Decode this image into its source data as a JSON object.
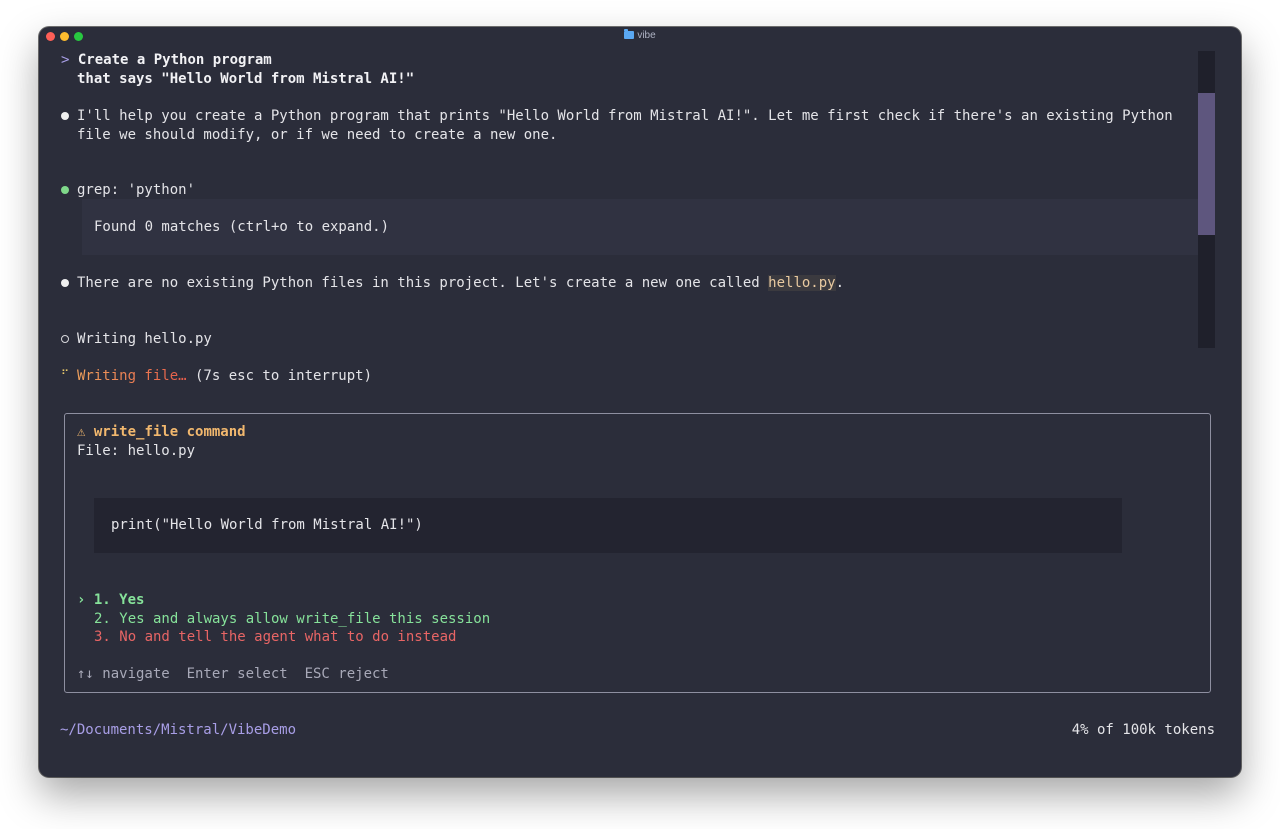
{
  "window": {
    "title": "vibe"
  },
  "conversation": {
    "prompt_char": ">",
    "user_line1": "Create a Python program",
    "user_line2": "that says \"Hello World from Mistral AI!\"",
    "assistant_msg1_line1": "I'll help you create a Python program that prints \"Hello World from Mistral AI!\". Let me first check if there's an existing Python",
    "assistant_msg1_line2": "file we should modify, or if we need to create a new one.",
    "tool_call": "grep: 'python'",
    "tool_result": "Found 0 matches (ctrl+o to expand.)",
    "assistant_msg2_prefix": "There are no existing Python files in this project. Let's create a new one called ",
    "assistant_msg2_code": "hello.py",
    "assistant_msg2_suffix": ".",
    "pending_action": "Writing hello.py",
    "status_spinner": "⠋",
    "status_active": "Writing file…",
    "status_detail": " (7s esc to interrupt)"
  },
  "approval": {
    "warning_icon": "⚠",
    "command_title": "write_file command",
    "file_label": "File: hello.py",
    "code": "print(\"Hello World from Mistral AI!\")",
    "selector": "›",
    "options": [
      "1. Yes",
      "2. Yes and always allow write_file this session",
      "3. No and tell the agent what to do instead"
    ],
    "hints": "↑↓ navigate  Enter select  ESC reject"
  },
  "footer": {
    "cwd": "~/Documents/Mistral/VibeDemo",
    "tokens": "4% of 100k tokens"
  },
  "colors": {
    "background": "#2b2d3a",
    "accent_purple": "#a89ee6",
    "success_green": "#86e29a",
    "danger_red": "#e86565",
    "warning_orange": "#f2b86e"
  }
}
